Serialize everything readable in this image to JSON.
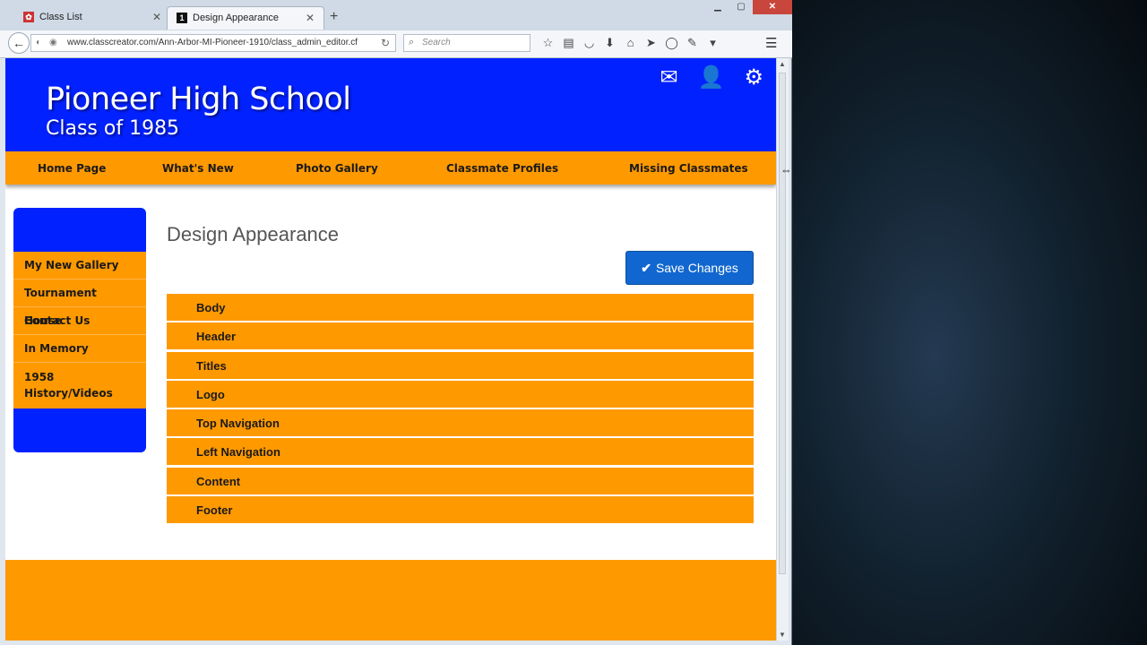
{
  "browser": {
    "tabs": [
      {
        "label": "Class List",
        "icon": "site-icon"
      },
      {
        "label": "Design Appearance",
        "icon": "1"
      }
    ],
    "url": "www.classcreator.com/Ann-Arbor-MI-Pioneer-1910/class_admin_editor.cf",
    "search_placeholder": "Search"
  },
  "site": {
    "school_name": "Pioneer High School",
    "class_of": "Class of 1985",
    "colors": {
      "header": "#0221ff",
      "accent": "#ff9900",
      "button": "#1167cf"
    },
    "top_nav": [
      "Home Page",
      "What's New",
      "Photo Gallery",
      "Classmate Profiles",
      "Missing Classmates"
    ],
    "left_nav": [
      "My New Gallery",
      "Tournament House",
      "Contact Us",
      "In Memory",
      "1958 History/Videos"
    ]
  },
  "main": {
    "title": "Design Appearance",
    "save_label": "Save Changes",
    "sections": [
      "Body",
      "Header",
      "Titles",
      "Logo",
      "Top Navigation",
      "Left Navigation",
      "Content",
      "Footer"
    ]
  }
}
